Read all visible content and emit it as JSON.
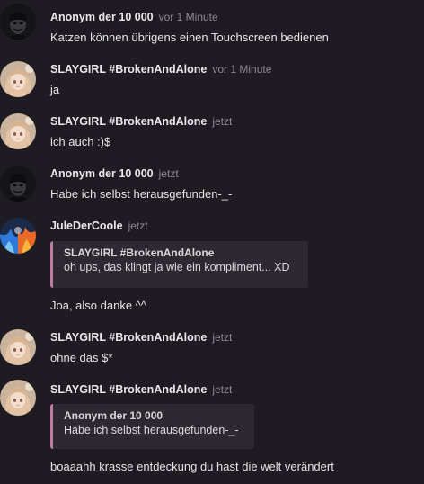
{
  "messages": [
    {
      "author": "Anonym der 10 000",
      "time": "vor 1 Minute",
      "text": "Katzen können übrigens einen Touchscreen bedienen",
      "avatar": "anonymous-mask-avatar"
    },
    {
      "author": "SLAYGIRL #BrokenAndAlone",
      "time": "vor 1 Minute",
      "text": "ja",
      "avatar": "anime-girl-avatar"
    },
    {
      "author": "SLAYGIRL #BrokenAndAlone",
      "time": "jetzt",
      "text": "ich auch :)$",
      "avatar": "anime-girl-avatar"
    },
    {
      "author": "Anonym der 10 000",
      "time": "jetzt",
      "text": "Habe ich selbst herausgefunden-_-",
      "avatar": "anonymous-mask-avatar"
    },
    {
      "author": "JuleDerCoole",
      "time": "jetzt",
      "quote_author": "SLAYGIRL #BrokenAndAlone",
      "quote_text": "oh ups, das klingt ja wie ein kompliment... XD",
      "text": "Joa, also danke ^^",
      "avatar": "fire-ice-avatar"
    },
    {
      "author": "SLAYGIRL #BrokenAndAlone",
      "time": "jetzt",
      "text": "ohne das $*",
      "avatar": "anime-girl-avatar"
    },
    {
      "author": "SLAYGIRL #BrokenAndAlone",
      "time": "jetzt",
      "quote_author": "Anonym der 10 000",
      "quote_text": "Habe ich selbst herausgefunden-_-",
      "text": "boaaahh krasse entdeckung du hast die welt verändert",
      "avatar": "anime-girl-avatar"
    }
  ],
  "colors": {
    "background": "#1e1b22",
    "quote_bar": "#c07aa6",
    "quote_bg": "#2c2930",
    "timestamp": "#8f8b95"
  }
}
